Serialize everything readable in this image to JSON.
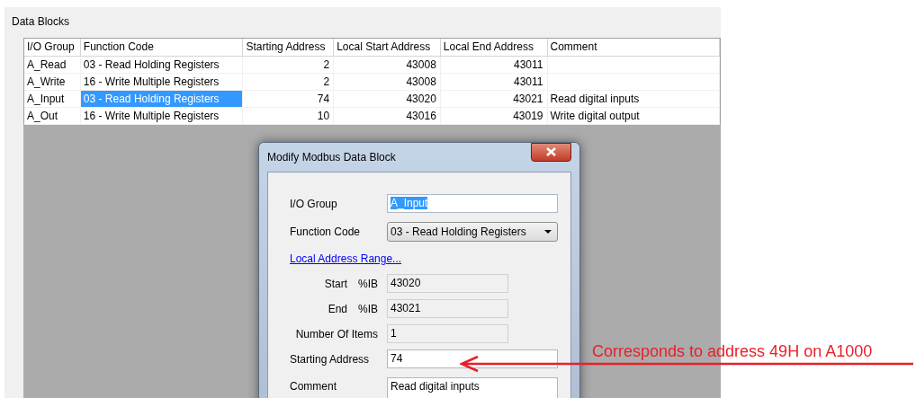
{
  "panel": {
    "title": "Data Blocks"
  },
  "table": {
    "columns": [
      {
        "label": "I/O Group",
        "kind": "text"
      },
      {
        "label": "Function Code",
        "kind": "text"
      },
      {
        "label": "Starting Address",
        "kind": "number"
      },
      {
        "label": "Local Start Address",
        "kind": "number"
      },
      {
        "label": "Local End Address",
        "kind": "number"
      },
      {
        "label": "Comment",
        "kind": "text"
      }
    ],
    "rows": [
      {
        "cells": [
          "A_Read",
          "03 - Read Holding Registers",
          "2",
          "43008",
          "43011",
          ""
        ],
        "selected": false
      },
      {
        "cells": [
          "A_Write",
          "16 - Write Multiple Registers",
          "2",
          "43008",
          "43011",
          ""
        ],
        "selected": false
      },
      {
        "cells": [
          "A_Input",
          "03 - Read Holding Registers",
          "74",
          "43020",
          "43021",
          "Read digital inputs"
        ],
        "selected": true
      },
      {
        "cells": [
          "A_Out",
          "16 - Write Multiple Registers",
          "10",
          "43016",
          "43019",
          "Write digital output"
        ],
        "selected": false
      }
    ]
  },
  "dialog": {
    "title": "Modify Modbus Data Block",
    "items": [
      {
        "kind": "text",
        "label": "I/O Group",
        "value": "A_Input",
        "highlighted": true
      },
      {
        "kind": "combo",
        "label": "Function Code",
        "value": "03 - Read Holding Registers",
        "highlighted": false
      },
      {
        "kind": "link",
        "label": "Local Address Range...",
        "highlighted": false
      },
      {
        "kind": "readonly",
        "label": "Start",
        "prefix": "%IB",
        "value": "43020",
        "highlighted": false
      },
      {
        "kind": "readonly",
        "label": "End",
        "prefix": "%IB",
        "value": "43021",
        "highlighted": false
      },
      {
        "kind": "readonly",
        "label": "Number Of Items",
        "value": "1",
        "highlighted": false
      },
      {
        "kind": "text",
        "label": "Starting Address",
        "value": "74",
        "highlighted": false
      },
      {
        "kind": "text",
        "label": "Comment",
        "value": "Read digital inputs",
        "highlighted": false
      }
    ]
  },
  "annotation": {
    "text": "Corresponds to address 49H on A1000"
  }
}
